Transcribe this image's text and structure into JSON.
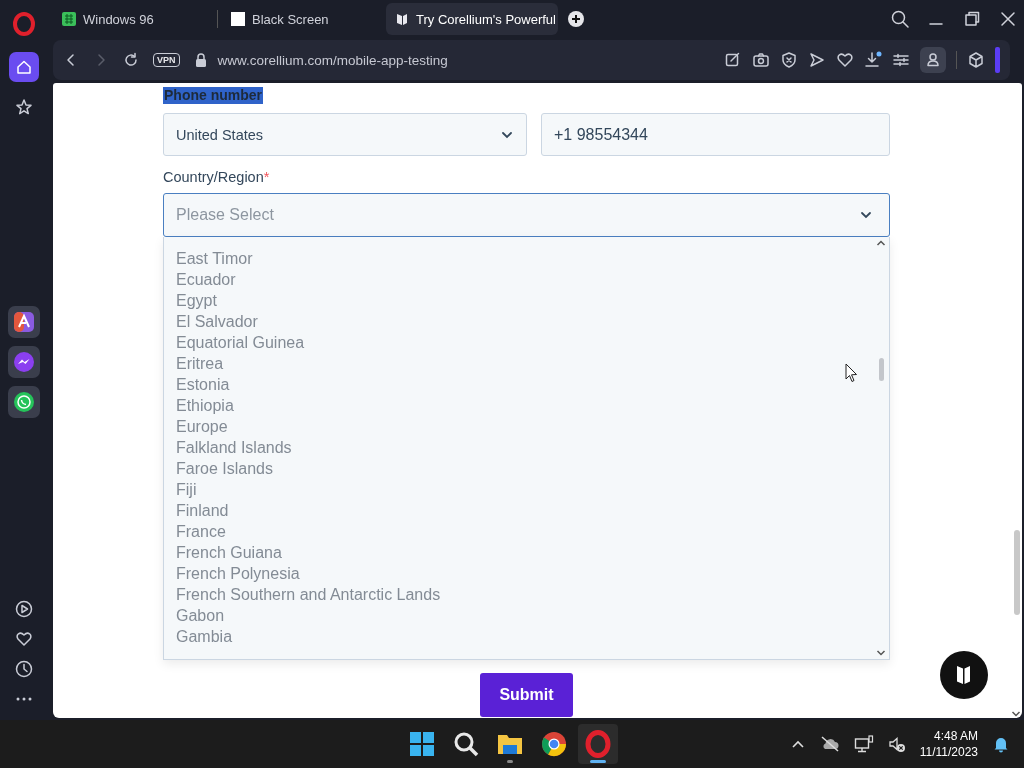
{
  "browser": {
    "tabs": [
      {
        "title": "Windows 96",
        "kind": "grid",
        "selected": false
      },
      {
        "title": "Black Screen",
        "kind": "square",
        "selected": false
      },
      {
        "title": "Try Corellium's Powerful",
        "kind": "logo",
        "selected": true
      }
    ],
    "address_bar": {
      "vpn": "VPN",
      "url": "www.corellium.com/mobile-app-testing"
    },
    "sidebar": {
      "items": [
        {
          "kind": "home",
          "selected": true
        },
        {
          "kind": "star",
          "selected": false
        }
      ],
      "apps": [
        {
          "kind": "aria"
        },
        {
          "kind": "messenger"
        },
        {
          "kind": "whatsapp"
        }
      ],
      "bottom": [
        {
          "kind": "play"
        },
        {
          "kind": "heart"
        },
        {
          "kind": "history"
        },
        {
          "kind": "more"
        }
      ]
    }
  },
  "form": {
    "phone_label": "Phone number",
    "phone_country": "United States",
    "phone_number": "+1 98554344",
    "country_label": "Country/Region",
    "required_mark": "*",
    "country_placeholder": "Please Select",
    "options": [
      "East Timor",
      "Ecuador",
      "Egypt",
      "El Salvador",
      "Equatorial Guinea",
      "Eritrea",
      "Estonia",
      "Ethiopia",
      "Europe",
      "Falkland Islands",
      "Faroe Islands",
      "Fiji",
      "Finland",
      "France",
      "French Guiana",
      "French Polynesia",
      "French Southern and Antarctic Lands",
      "Gabon",
      "Gambia"
    ],
    "submit": "Submit"
  },
  "taskbar": {
    "apps": [
      {
        "kind": "start",
        "active": false,
        "running": false
      },
      {
        "kind": "search",
        "active": false,
        "running": false
      },
      {
        "kind": "files",
        "active": false,
        "running": true
      },
      {
        "kind": "chrome",
        "active": false,
        "running": false
      },
      {
        "kind": "opera",
        "active": true,
        "running": true
      }
    ],
    "time": "4:48 AM",
    "date": "11/11/2023"
  }
}
